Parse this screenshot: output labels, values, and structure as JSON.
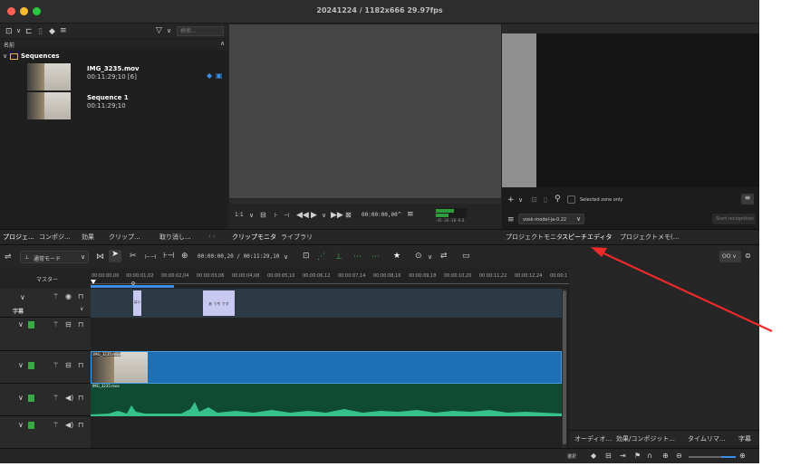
{
  "window": {
    "title": "20241224 / 1182x666 29.97fps",
    "colors": {
      "close": "#ff5f57",
      "minimize": "#febc2e",
      "zoom": "#28c840",
      "accent": "#3a8ee6"
    }
  },
  "bin": {
    "search_placeholder": "検索...",
    "header_name": "名前",
    "folder_label": "Sequences",
    "items": [
      {
        "title": "IMG_3235.mov",
        "meta": "00:11:29;10 [6]"
      },
      {
        "title": "Sequence 1",
        "meta": "00:11:29;10"
      }
    ]
  },
  "left_tabs": [
    "プロジェ...",
    "コンポジ...",
    "効果",
    "クリップ...",
    "取り消し..."
  ],
  "monitor": {
    "zoom": "1:1",
    "timecode": "00:00:00,00",
    "meter_labels": [
      "-45",
      "-30",
      "-18",
      "-6",
      "0"
    ],
    "tabs": [
      "クリップモニタ",
      "ライブラリ"
    ]
  },
  "speech": {
    "selected_zone_label": "Selected zone only",
    "model": "vosk-model-ja-0.22",
    "start_button": "Start recognition",
    "tabs": [
      "プロジェクトモニタ",
      "スピーチエディタ",
      "プロジェクトメモ(..."
    ]
  },
  "timeline": {
    "mode": "通常モード",
    "position": "00:00:00,20 / 00:11:29,10",
    "master_label": "マスター",
    "subtitle_label": "字幕",
    "ruler": [
      "00:00:00,00",
      "00:00:01,02",
      "00:00:02,04",
      "00:00:03,06",
      "00:00:04,08",
      "00:00:05,10",
      "00:00:06,12",
      "00:00:07,14",
      "00:00:08,16",
      "00:00:09,18",
      "00:00:10,20",
      "00:00:11,22",
      "00:00:12,24",
      "00:00:1"
    ],
    "subtitle_clips": [
      {
        "text": "はい"
      },
      {
        "text": "あ うち です"
      }
    ],
    "video_clip_label": "IMG_3235.mov",
    "audio_clip_label": "IMG_3235.mov",
    "zoom_toggle": "OO"
  },
  "bottom_tabs": [
    "オーディオ...",
    "効果/コンポジット...",
    "タイムリマ...",
    "字幕"
  ],
  "status": {
    "select_label": "選択"
  }
}
